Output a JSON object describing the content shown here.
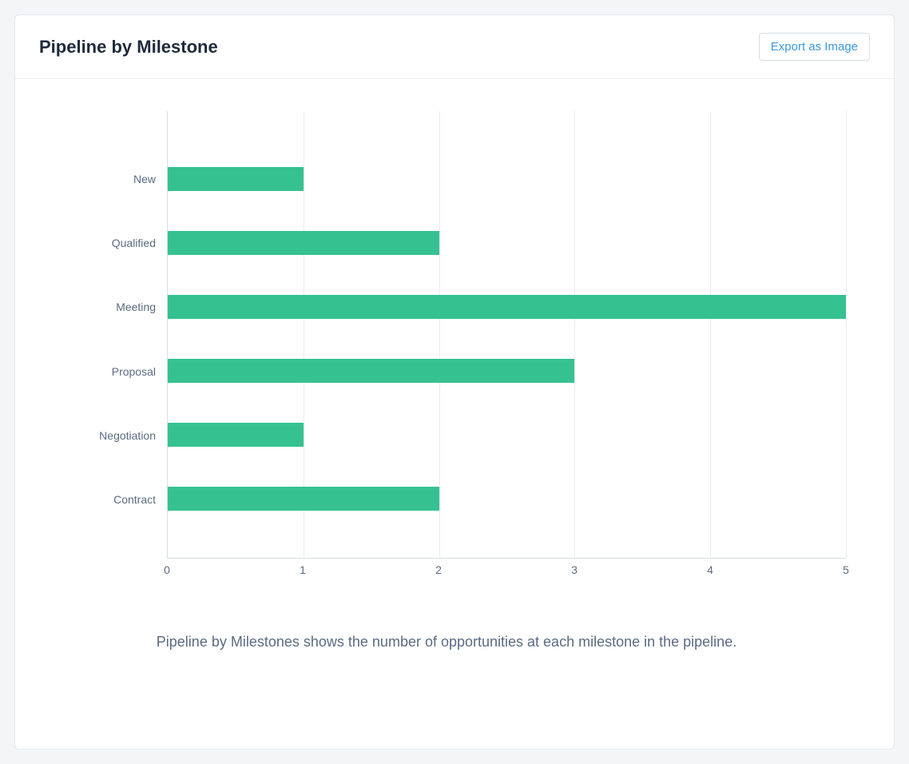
{
  "header": {
    "title": "Pipeline by Milestone",
    "export_label": "Export as Image"
  },
  "caption": "Pipeline by Milestones shows the number of opportunities at each milestone in the pipeline.",
  "chart_data": {
    "type": "bar",
    "orientation": "horizontal",
    "categories": [
      "New",
      "Qualified",
      "Meeting",
      "Proposal",
      "Negotiation",
      "Contract"
    ],
    "values": [
      1,
      2,
      5,
      3,
      1,
      2
    ],
    "xlim": [
      0,
      5
    ],
    "x_ticks": [
      0,
      1,
      2,
      3,
      4,
      5
    ],
    "bar_color": "#36c191",
    "xlabel": "",
    "ylabel": ""
  }
}
